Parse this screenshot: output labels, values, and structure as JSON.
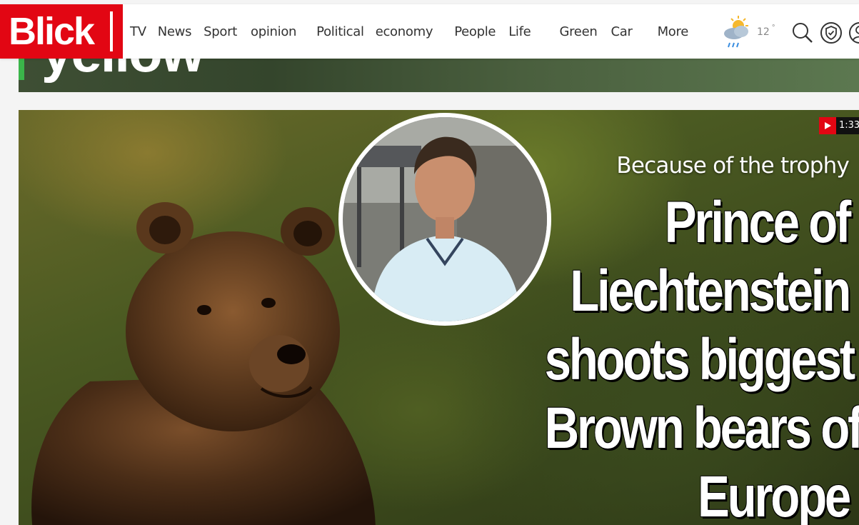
{
  "brand": {
    "name": "Blick",
    "color": "#e20613"
  },
  "nav": {
    "items": [
      {
        "label": "TV"
      },
      {
        "label": "News"
      },
      {
        "label": "Sport"
      },
      {
        "label": "opinion"
      },
      {
        "label": "Political"
      },
      {
        "label": "economy"
      },
      {
        "label": "People"
      },
      {
        "label": "Life"
      },
      {
        "label": "Green"
      },
      {
        "label": "Car"
      },
      {
        "label": "More"
      }
    ]
  },
  "header": {
    "weather_icon": "cloud-sun-rain-icon",
    "temperature": "12",
    "temperature_unit": "°",
    "icons": [
      "search-icon",
      "shield-icon",
      "user-icon"
    ]
  },
  "previous_teaser": {
    "headline_fragment": "yellow"
  },
  "teaser": {
    "video_duration": "1:33",
    "kicker": "Because of the trophy",
    "headline_lines": [
      "Prince of",
      "Liechtenstein",
      "shoots biggest",
      "Brown bears of",
      "Europe"
    ]
  }
}
